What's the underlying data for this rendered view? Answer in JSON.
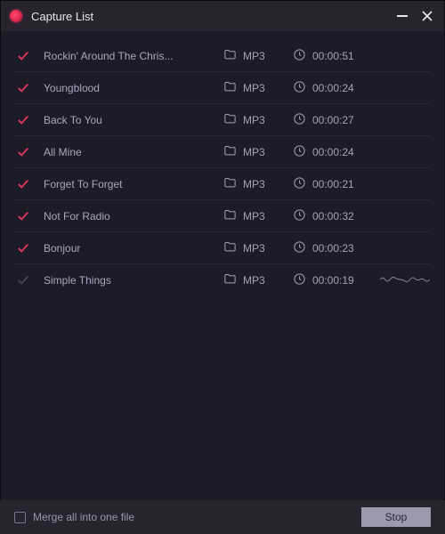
{
  "window": {
    "title": "Capture List"
  },
  "tracks": [
    {
      "name": "Rockin' Around The Chris...",
      "format": "MP3",
      "duration": "00:00:51",
      "completed": true,
      "recording": false
    },
    {
      "name": "Youngblood",
      "format": "MP3",
      "duration": "00:00:24",
      "completed": true,
      "recording": false
    },
    {
      "name": "Back To You",
      "format": "MP3",
      "duration": "00:00:27",
      "completed": true,
      "recording": false
    },
    {
      "name": "All Mine",
      "format": "MP3",
      "duration": "00:00:24",
      "completed": true,
      "recording": false
    },
    {
      "name": "Forget To Forget",
      "format": "MP3",
      "duration": "00:00:21",
      "completed": true,
      "recording": false
    },
    {
      "name": "Not For Radio",
      "format": "MP3",
      "duration": "00:00:32",
      "completed": true,
      "recording": false
    },
    {
      "name": "Bonjour",
      "format": "MP3",
      "duration": "00:00:23",
      "completed": true,
      "recording": false
    },
    {
      "name": "Simple Things",
      "format": "MP3",
      "duration": "00:00:19",
      "completed": false,
      "recording": true
    }
  ],
  "footer": {
    "merge_label": "Merge all into one file",
    "merge_checked": false,
    "stop_label": "Stop"
  },
  "colors": {
    "accent": "#e23a5e",
    "bg": "#1e1b29",
    "panel": "#27232f"
  }
}
